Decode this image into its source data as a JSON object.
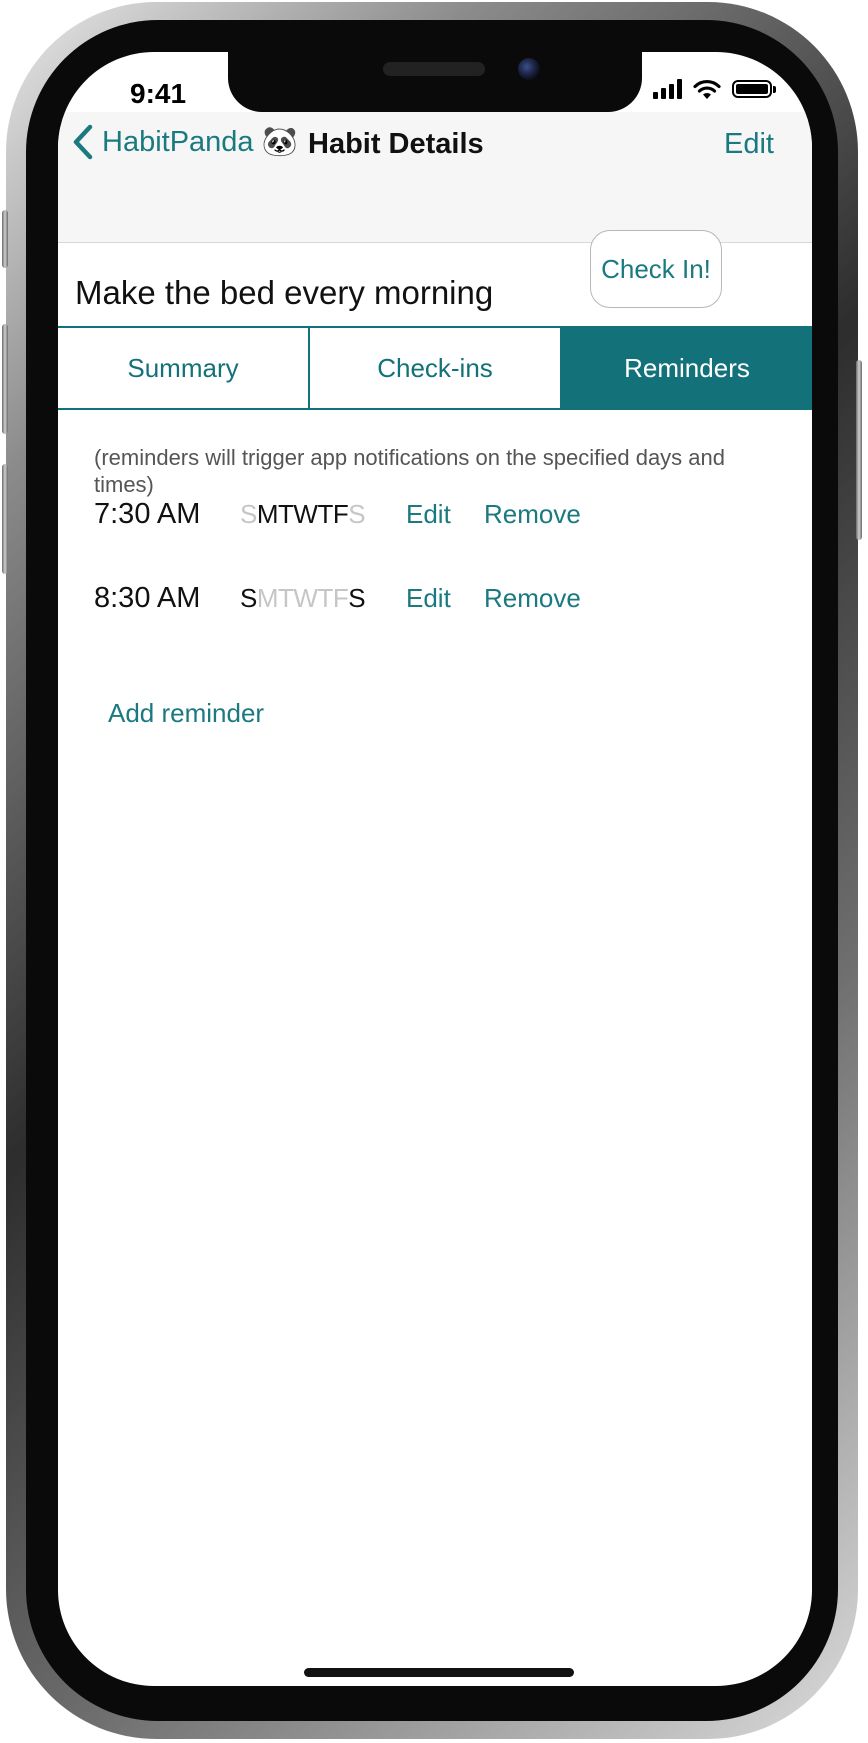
{
  "status_bar": {
    "time": "9:41"
  },
  "navbar": {
    "back_label": "HabitPanda 🐼",
    "title": "Habit Details",
    "edit_label": "Edit"
  },
  "habit": {
    "name": "Make the bed every morning",
    "check_in_label": "Check In!"
  },
  "tabs": [
    {
      "label": "Summary",
      "active": false
    },
    {
      "label": "Check-ins",
      "active": false
    },
    {
      "label": "Reminders",
      "active": true
    }
  ],
  "reminders_note": "(reminders will trigger app notifications on the specified days and times)",
  "reminders": [
    {
      "time": "7:30 AM",
      "days": [
        {
          "letter": "S",
          "on": false
        },
        {
          "letter": "M",
          "on": true
        },
        {
          "letter": "T",
          "on": true
        },
        {
          "letter": "W",
          "on": true
        },
        {
          "letter": "T",
          "on": true
        },
        {
          "letter": "F",
          "on": true
        },
        {
          "letter": "S",
          "on": false
        }
      ],
      "edit_label": "Edit",
      "remove_label": "Remove"
    },
    {
      "time": "8:30 AM",
      "days": [
        {
          "letter": "S",
          "on": true
        },
        {
          "letter": "M",
          "on": false
        },
        {
          "letter": "T",
          "on": false
        },
        {
          "letter": "W",
          "on": false
        },
        {
          "letter": "T",
          "on": false
        },
        {
          "letter": "F",
          "on": false
        },
        {
          "letter": "S",
          "on": true
        }
      ],
      "edit_label": "Edit",
      "remove_label": "Remove"
    }
  ],
  "add_reminder_label": "Add reminder",
  "colors": {
    "accent": "#137279",
    "link": "#1a7a80",
    "day_off": "#c6c6c6",
    "navbar_bg": "#f6f6f6"
  },
  "icons": {
    "back": "chevron-left-icon",
    "signal": "cellular-signal-icon",
    "wifi": "wifi-icon",
    "battery": "battery-icon"
  }
}
